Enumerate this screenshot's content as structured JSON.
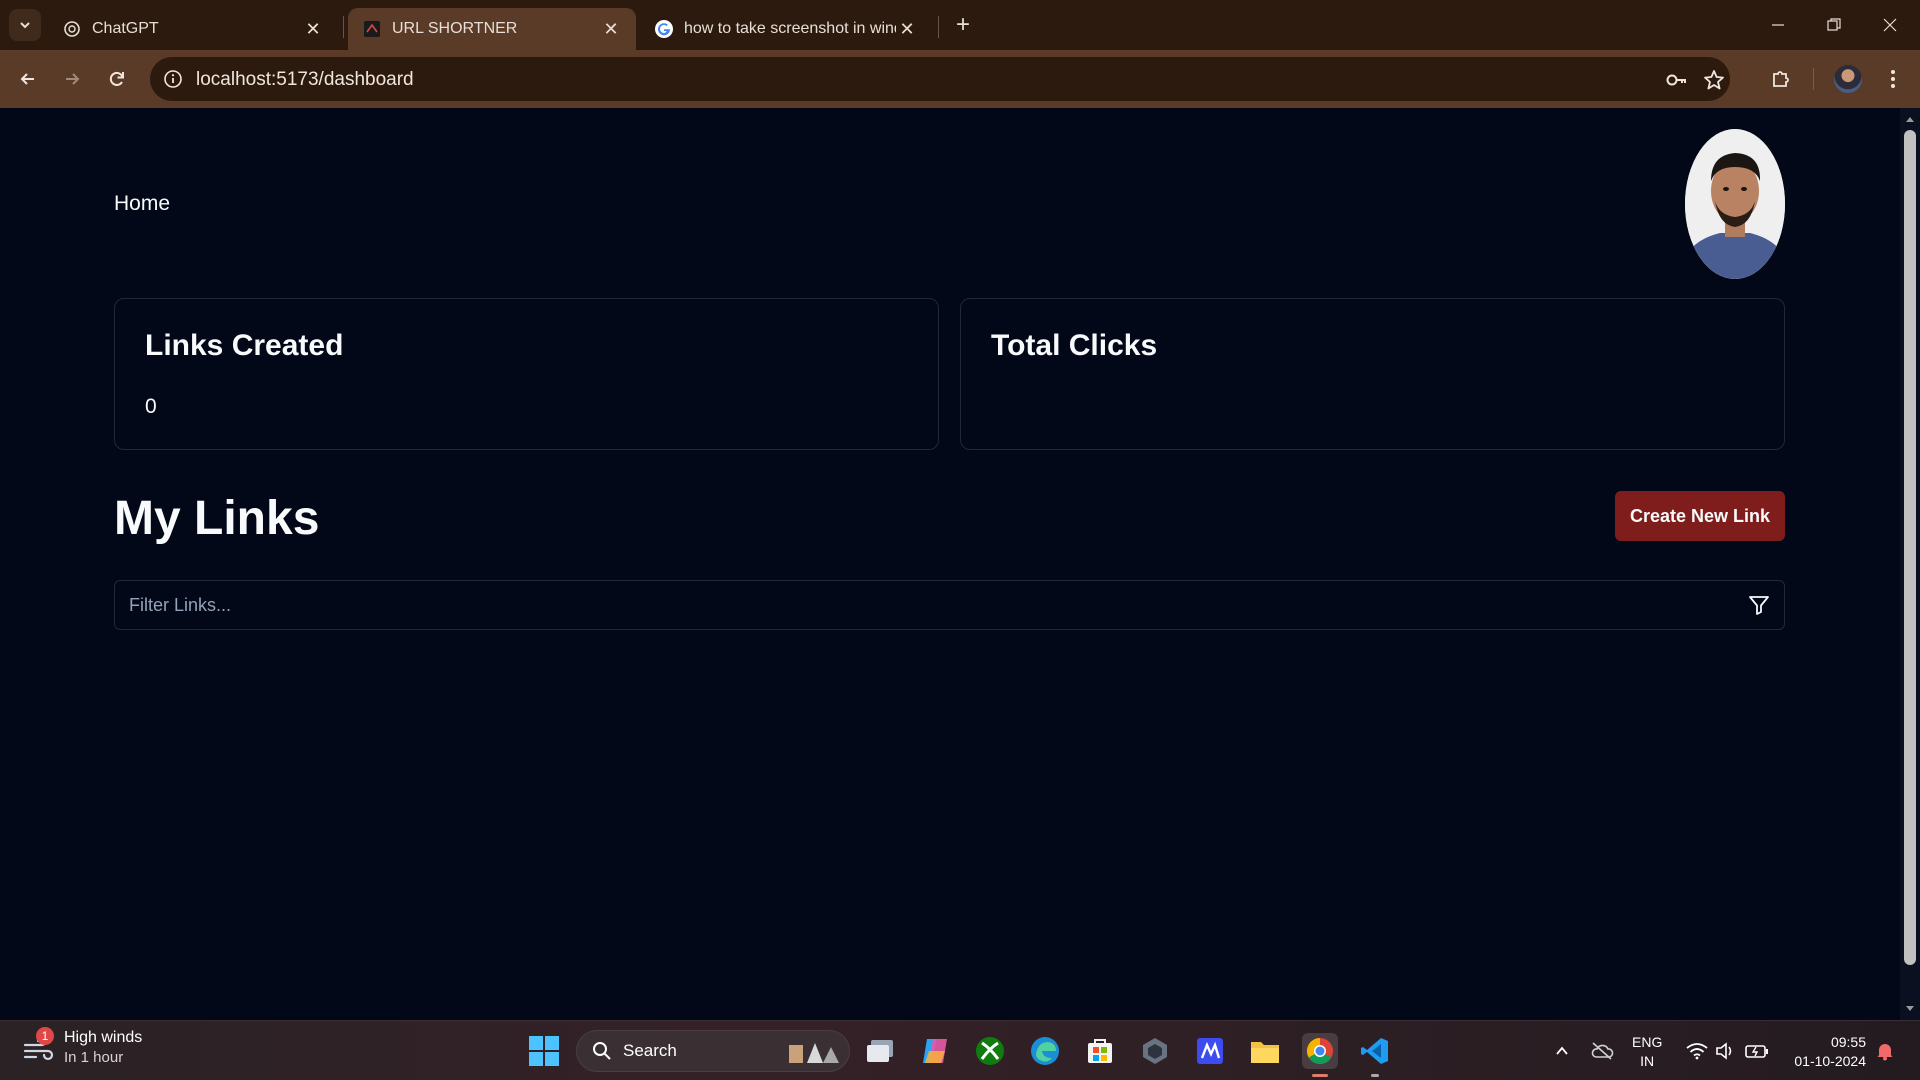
{
  "browser": {
    "tabs": [
      {
        "title": "ChatGPT",
        "active": false
      },
      {
        "title": "URL SHORTNER",
        "active": true
      },
      {
        "title": "how to take screenshot in windo",
        "active": false
      }
    ],
    "new_tab_symbol": "+",
    "close_symbol": "✕",
    "url": "localhost:5173/dashboard"
  },
  "page": {
    "nav": {
      "home_label": "Home"
    },
    "stats": [
      {
        "title": "Links Created",
        "value": "0"
      },
      {
        "title": "Total Clicks",
        "value": ""
      }
    ],
    "section_title": "My Links",
    "create_button_label": "Create New Link",
    "filter": {
      "value": "",
      "placeholder": "Filter Links..."
    }
  },
  "taskbar": {
    "weather": {
      "title": "High winds",
      "subtitle": "In 1 hour",
      "badge": "1"
    },
    "search_label": "Search",
    "language": {
      "line1": "ENG",
      "line2": "IN"
    },
    "clock": {
      "time": "09:55",
      "date": "01-10-2024"
    }
  },
  "colors": {
    "page_bg": "#020817",
    "card_border": "#1e293b",
    "accent_button": "#7f1d1d",
    "chrome_dark": "#2c1a0e",
    "chrome_light": "#5a3b27"
  }
}
